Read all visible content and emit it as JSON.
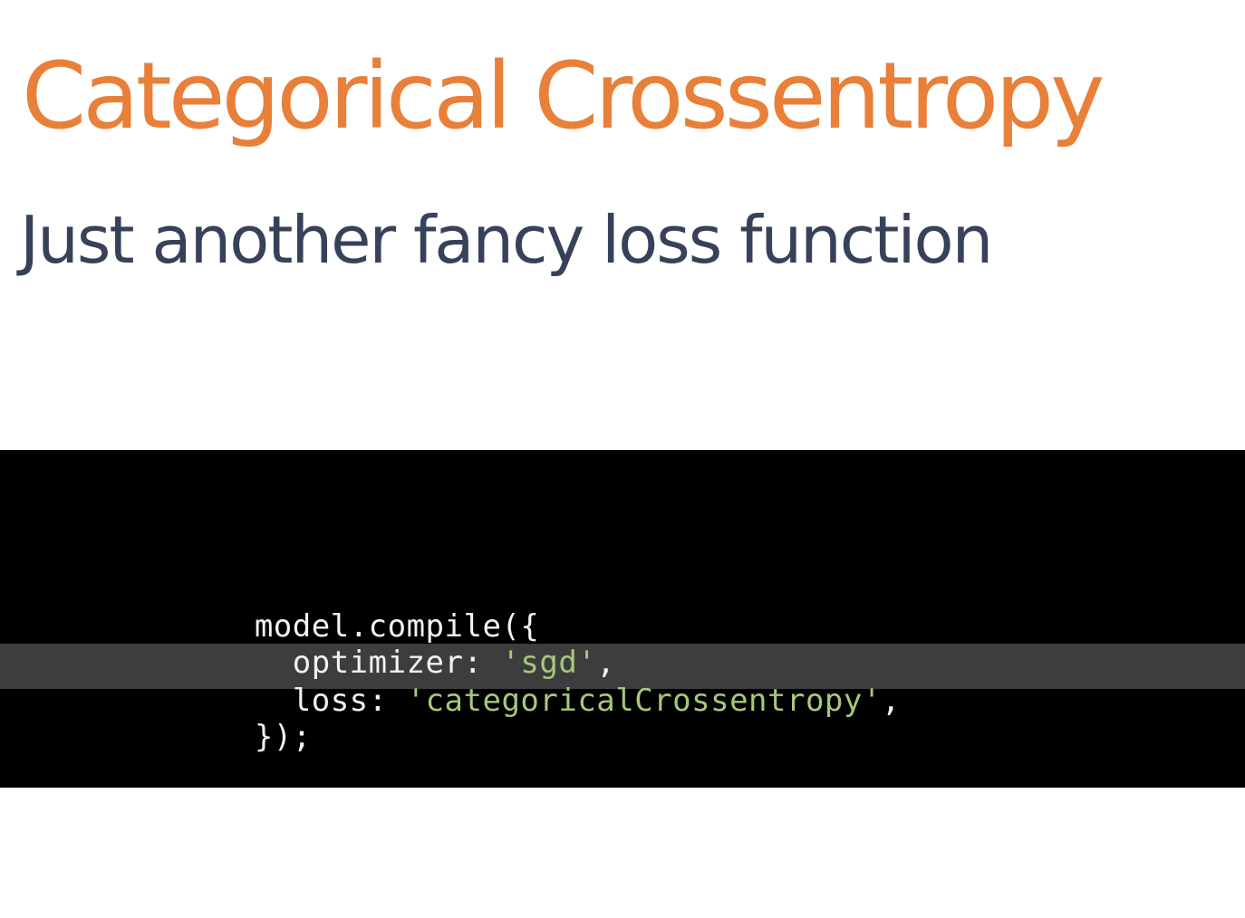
{
  "slide": {
    "title": "Categorical Crossentropy",
    "subtitle": "Just another fancy loss function",
    "colors": {
      "title": "#e8803a",
      "subtitle": "#36415a",
      "code_background": "#000000",
      "code_highlight": "#3d3d3d",
      "code_text": "#f2f2f2",
      "code_string": "#a6c87a"
    }
  },
  "code": {
    "line1": "model.compile({",
    "line2_key": "  optimizer: ",
    "line2_value": "'sgd'",
    "line2_end": ",",
    "line3_key": "  loss: ",
    "line3_value": "'categoricalCrossentropy'",
    "line3_end": ",",
    "line4": "});",
    "highlighted_line": 3
  }
}
